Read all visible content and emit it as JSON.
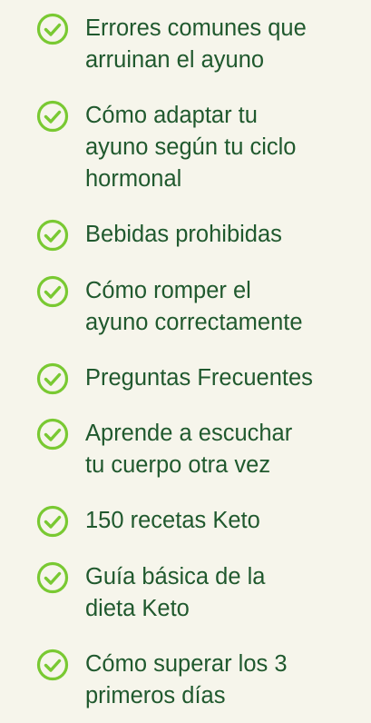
{
  "checklist": {
    "items": [
      {
        "label": "Errores comunes que\narruinan el ayuno",
        "icon": "check-circle-icon"
      },
      {
        "label": "Cómo adaptar tu\nayuno según tu ciclo\nhormonal",
        "icon": "check-circle-icon"
      },
      {
        "label": "Bebidas prohibidas",
        "icon": "check-circle-icon"
      },
      {
        "label": "Cómo romper el\nayuno correctamente",
        "icon": "check-circle-icon"
      },
      {
        "label": "Preguntas Frecuentes",
        "icon": "check-circle-icon"
      },
      {
        "label": "Aprende a escuchar\ntu cuerpo otra vez",
        "icon": "check-circle-icon"
      },
      {
        "label": "150 recetas Keto",
        "icon": "check-circle-icon"
      },
      {
        "label": "Guía básica de la\ndieta Keto",
        "icon": "check-circle-icon"
      },
      {
        "label": "Cómo superar los 3\nprimeros días",
        "icon": "check-circle-icon"
      }
    ]
  },
  "colors": {
    "background": "#f6f5eb",
    "text": "#20592e",
    "icon": "#79c932"
  }
}
